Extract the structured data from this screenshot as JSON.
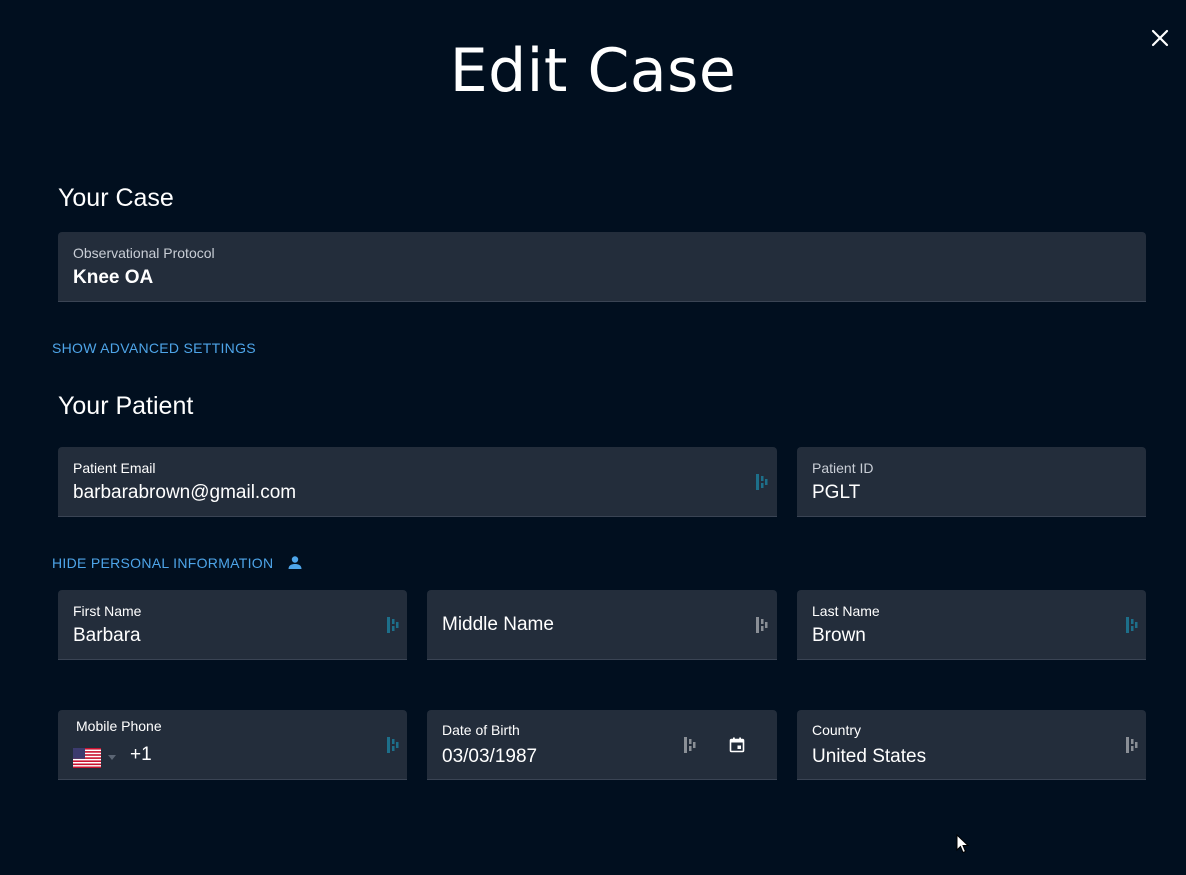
{
  "dialog": {
    "title": "Edit Case"
  },
  "case_section": {
    "heading": "Your Case",
    "protocol_label": "Observational Protocol",
    "protocol_value": "Knee OA",
    "advanced_link": "SHOW ADVANCED SETTINGS"
  },
  "patient_section": {
    "heading": "Your Patient",
    "email_label": "Patient Email",
    "email_value": "barbarabrown@gmail.com",
    "patient_id_label": "Patient ID",
    "patient_id_value": "PGLT",
    "hide_info_link": "HIDE PERSONAL INFORMATION",
    "first_name_label": "First Name",
    "first_name_value": "Barbara",
    "middle_name_placeholder": "Middle Name",
    "last_name_label": "Last Name",
    "last_name_value": "Brown",
    "phone_label": "Mobile Phone",
    "phone_value": "+1",
    "dob_label": "Date of Birth",
    "dob_value": "03/03/1987",
    "country_label": "Country",
    "country_value": "United States"
  },
  "icons": {
    "close": "close-icon",
    "password_manager": "password-manager-icon",
    "calendar": "calendar-icon",
    "person": "person-icon",
    "flag": "us-flag-icon"
  },
  "colors": {
    "background": "#010f1f",
    "field": "#232d3b",
    "link": "#4ea5e9",
    "pw_icon_active": "#1d6f8a",
    "pw_icon_inactive": "#8a8f96"
  }
}
